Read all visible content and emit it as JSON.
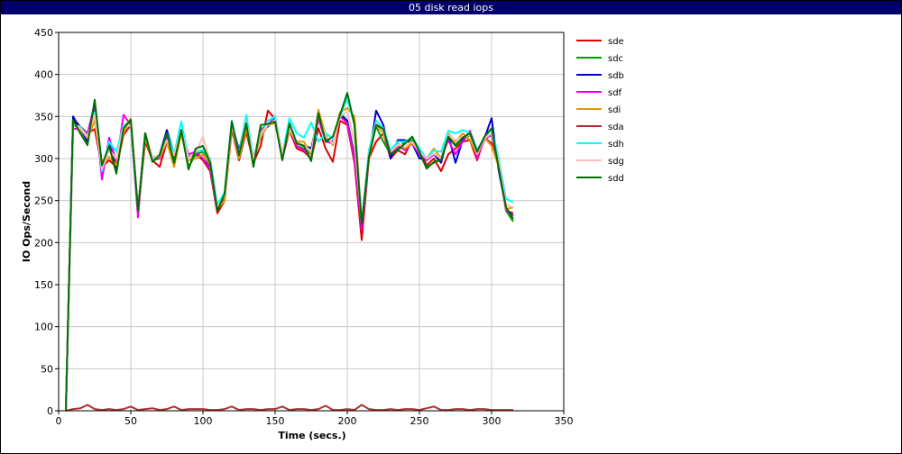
{
  "window": {
    "title": "05 disk read iops"
  },
  "chart_data": {
    "type": "line",
    "title": "05 disk read iops",
    "xlabel": "Time (secs.)",
    "ylabel": "IO Ops/Second",
    "xlim": [
      0,
      350
    ],
    "ylim": [
      0,
      450
    ],
    "x_ticks": [
      0,
      50,
      100,
      150,
      200,
      250,
      300,
      350
    ],
    "y_ticks": [
      0,
      50,
      100,
      150,
      200,
      250,
      300,
      350,
      400,
      450
    ],
    "grid": true,
    "legend_position": "right",
    "x": [
      5,
      10,
      15,
      20,
      25,
      30,
      35,
      40,
      45,
      50,
      55,
      60,
      65,
      70,
      75,
      80,
      85,
      90,
      95,
      100,
      105,
      110,
      115,
      120,
      125,
      130,
      135,
      140,
      145,
      150,
      155,
      160,
      165,
      170,
      175,
      180,
      185,
      190,
      195,
      200,
      205,
      210,
      215,
      220,
      225,
      230,
      235,
      240,
      245,
      250,
      255,
      260,
      265,
      270,
      275,
      280,
      285,
      290,
      295,
      300,
      305,
      310,
      315
    ],
    "series": [
      {
        "name": "sde",
        "color": "#e00000",
        "values": [
          0,
          348,
          338,
          330,
          335,
          290,
          298,
          290,
          328,
          340,
          238,
          320,
          298,
          290,
          320,
          300,
          330,
          302,
          305,
          298,
          285,
          235,
          250,
          335,
          298,
          332,
          295,
          315,
          357,
          347,
          300,
          333,
          312,
          308,
          300,
          336,
          312,
          296,
          345,
          340,
          295,
          203,
          300,
          320,
          330,
          300,
          310,
          305,
          322,
          312,
          292,
          300,
          285,
          305,
          312,
          320,
          322,
          298,
          325,
          318,
          300,
          238,
          235
        ]
      },
      {
        "name": "sdc",
        "color": "#00a000",
        "values": [
          0,
          345,
          335,
          322,
          368,
          292,
          312,
          292,
          338,
          345,
          240,
          330,
          298,
          300,
          328,
          300,
          332,
          290,
          305,
          308,
          290,
          240,
          255,
          338,
          308,
          350,
          295,
          335,
          340,
          345,
          300,
          338,
          315,
          312,
          305,
          350,
          325,
          318,
          355,
          345,
          305,
          222,
          305,
          338,
          320,
          305,
          312,
          320,
          322,
          305,
          290,
          295,
          300,
          325,
          315,
          322,
          328,
          305,
          322,
          330,
          290,
          238,
          225
        ]
      },
      {
        "name": "sdb",
        "color": "#0000d0",
        "values": [
          0,
          350,
          335,
          320,
          358,
          280,
          318,
          285,
          340,
          338,
          240,
          330,
          298,
          305,
          334,
          305,
          330,
          300,
          308,
          300,
          290,
          238,
          255,
          342,
          310,
          340,
          300,
          332,
          338,
          348,
          305,
          335,
          318,
          316,
          312,
          350,
          322,
          320,
          352,
          345,
          300,
          220,
          300,
          357,
          340,
          300,
          322,
          322,
          318,
          300,
          300,
          305,
          295,
          328,
          295,
          322,
          332,
          310,
          324,
          348,
          285,
          240,
          232
        ]
      },
      {
        "name": "sdf",
        "color": "#ee00ee",
        "values": [
          0,
          335,
          336,
          330,
          365,
          275,
          325,
          295,
          352,
          340,
          230,
          330,
          300,
          300,
          325,
          305,
          334,
          305,
          308,
          300,
          288,
          238,
          255,
          342,
          306,
          338,
          298,
          333,
          340,
          350,
          300,
          336,
          315,
          310,
          300,
          348,
          320,
          318,
          350,
          342,
          300,
          215,
          300,
          345,
          330,
          305,
          315,
          310,
          318,
          305,
          298,
          305,
          300,
          322,
          305,
          320,
          333,
          300,
          323,
          328,
          290,
          238,
          232
        ]
      },
      {
        "name": "sdi",
        "color": "#e09a00",
        "values": [
          0,
          340,
          335,
          324,
          345,
          290,
          302,
          292,
          330,
          348,
          240,
          325,
          298,
          302,
          320,
          290,
          330,
          298,
          300,
          305,
          293,
          240,
          250,
          340,
          300,
          335,
          300,
          325,
          340,
          342,
          305,
          333,
          320,
          320,
          305,
          358,
          328,
          316,
          355,
          360,
          350,
          225,
          300,
          340,
          330,
          308,
          318,
          312,
          318,
          310,
          300,
          312,
          300,
          330,
          320,
          330,
          322,
          305,
          325,
          315,
          290,
          240,
          242
        ]
      },
      {
        "name": "sda",
        "color": "#b03030",
        "values": [
          0,
          2,
          3,
          7,
          2,
          1,
          2,
          1,
          2,
          5,
          1,
          2,
          3,
          1,
          2,
          5,
          1,
          2,
          2,
          2,
          1,
          1,
          2,
          5,
          1,
          2,
          2,
          1,
          2,
          2,
          5,
          1,
          2,
          2,
          1,
          2,
          6,
          1,
          1,
          2,
          1,
          7,
          2,
          1,
          1,
          2,
          1,
          2,
          2,
          1,
          3,
          5,
          1,
          1,
          2,
          2,
          1,
          2,
          2,
          1,
          1,
          1,
          1
        ]
      },
      {
        "name": "sdh",
        "color": "#00ffff",
        "values": [
          0,
          340,
          338,
          326,
          355,
          285,
          320,
          308,
          340,
          338,
          240,
          330,
          300,
          305,
          330,
          305,
          344,
          300,
          308,
          310,
          300,
          245,
          260,
          345,
          305,
          352,
          302,
          328,
          345,
          350,
          305,
          348,
          330,
          325,
          343,
          320,
          330,
          324,
          350,
          372,
          340,
          225,
          310,
          345,
          336,
          310,
          320,
          320,
          325,
          312,
          300,
          310,
          308,
          333,
          330,
          334,
          330,
          310,
          325,
          335,
          300,
          252,
          248
        ]
      },
      {
        "name": "sdg",
        "color": "#ffbcbc",
        "values": [
          0,
          342,
          336,
          326,
          352,
          288,
          310,
          300,
          338,
          340,
          242,
          328,
          302,
          304,
          322,
          304,
          334,
          300,
          308,
          326,
          296,
          242,
          256,
          340,
          304,
          344,
          300,
          330,
          340,
          346,
          306,
          336,
          318,
          316,
          308,
          352,
          326,
          318,
          350,
          356,
          320,
          224,
          304,
          342,
          332,
          308,
          316,
          316,
          320,
          308,
          300,
          306,
          300,
          328,
          322,
          326,
          328,
          306,
          324,
          330,
          296,
          245,
          242
        ]
      },
      {
        "name": "sdd",
        "color": "#006f00",
        "values": [
          0,
          346,
          330,
          316,
          370,
          292,
          315,
          282,
          336,
          346,
          238,
          330,
          296,
          304,
          330,
          295,
          334,
          287,
          312,
          315,
          295,
          238,
          258,
          344,
          304,
          342,
          290,
          340,
          341,
          344,
          298,
          342,
          318,
          315,
          297,
          354,
          320,
          326,
          352,
          378,
          340,
          222,
          302,
          340,
          335,
          305,
          310,
          318,
          326,
          308,
          288,
          296,
          298,
          326,
          316,
          325,
          330,
          308,
          326,
          336,
          288,
          242,
          228
        ]
      }
    ]
  }
}
